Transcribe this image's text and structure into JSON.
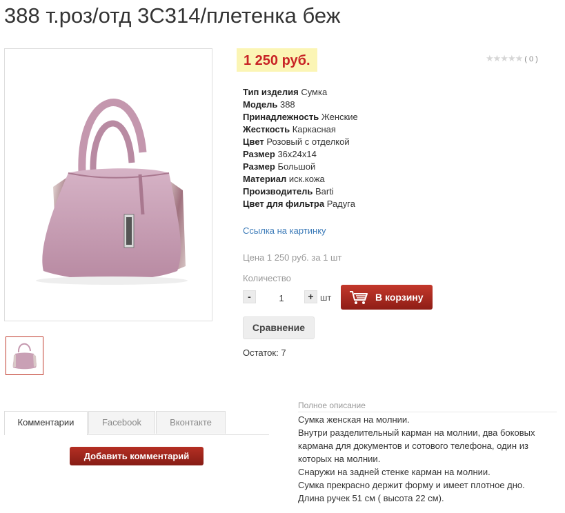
{
  "product": {
    "title": "388 т.роз/отд 3С314/плетенка беж",
    "price": "1 250 руб.",
    "rating": {
      "stars": "★★★★★",
      "count": "( 0 )",
      "value": 0,
      "max": 5
    },
    "properties": [
      {
        "name": "Тип изделия",
        "value": "Сумка"
      },
      {
        "name": "Модель",
        "value": "388"
      },
      {
        "name": "Принадлежность",
        "value": "Женские"
      },
      {
        "name": "Жесткость",
        "value": "Каркасная"
      },
      {
        "name": "Цвет",
        "value": "Розовый с отделкой"
      },
      {
        "name": "Размер",
        "value": "36x24x14"
      },
      {
        "name": "Размер",
        "value": "Большой"
      },
      {
        "name": "Материал",
        "value": "иск.кожа"
      },
      {
        "name": "Производитель",
        "value": "Barti"
      },
      {
        "name": "Цвет для фильтра",
        "value": "Радуга"
      }
    ],
    "image_link": "Ссылка на картинку",
    "price_line": "Цена 1 250 руб. за 1 шт",
    "quantity_label": "Количество",
    "quantity": "1",
    "minus": "-",
    "plus": "+",
    "unit": "шт",
    "cart_button": "В корзину",
    "compare_button": "Сравнение",
    "stock": "Остаток: 7"
  },
  "tabs": [
    {
      "label": "Комментарии",
      "active": true
    },
    {
      "label": "Facebook",
      "active": false
    },
    {
      "label": "Вконтакте",
      "active": false
    }
  ],
  "add_comment_button": "Добавить комментарий",
  "description": {
    "heading": "Полное описание",
    "lines": [
      "Сумка женская на молнии.",
      "Внутри разделительный карман на молнии, два боковых кармана для документов и сотового телефона, один из которых на молнии.",
      "Снаружи на задней стенке карман на молнии.",
      "Сумка прекрасно держит форму и имеет плотное дно.",
      "Длина ручек 51 см ( высота 22 см)."
    ]
  },
  "colors": {
    "price": "#c82325",
    "price_bg": "#fbf5b5",
    "link": "#3b7ab8",
    "button": "#a8291f",
    "bag": "#c9a0b5"
  },
  "icons": {
    "cart": "cart-icon",
    "bag_photo": "handbag-photo"
  }
}
